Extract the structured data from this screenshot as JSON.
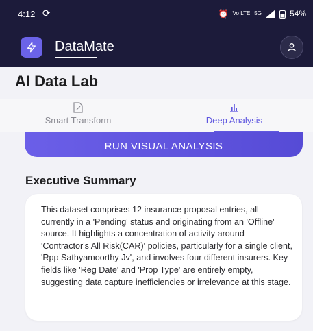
{
  "status_bar": {
    "time": "4:12",
    "sync_icon": "sync-icon",
    "alarm_icon": "alarm-icon",
    "network_label": "Vo LTE",
    "signal_label": "5G",
    "battery": "54%"
  },
  "app_bar": {
    "brand": "DataMate",
    "logo_icon": "lightning-icon",
    "profile_icon": "user-icon",
    "colors": {
      "background": "#1c1b3a",
      "accent": "#6b63e8"
    }
  },
  "page": {
    "title": "AI Data Lab"
  },
  "tabs": [
    {
      "label": "Smart Transform",
      "icon": "edit-document-icon",
      "active": false
    },
    {
      "label": "Deep Analysis",
      "icon": "bar-chart-icon",
      "active": true
    }
  ],
  "actions": {
    "run_label": "RUN VISUAL ANALYSIS"
  },
  "summary": {
    "title": "Executive Summary",
    "text": "This dataset comprises 12 insurance proposal entries, all currently in a 'Pending' status and originating from an 'Offline' source. It highlights a concentration of activity around 'Contractor's All Risk(CAR)' policies, particularly for a single client, 'Rpp Sathyamoorthy Jv', and involves four different insurers. Key fields like 'Reg Date' and 'Prop Type' are entirely empty, suggesting data capture inefficiencies or irrelevance at this stage."
  }
}
